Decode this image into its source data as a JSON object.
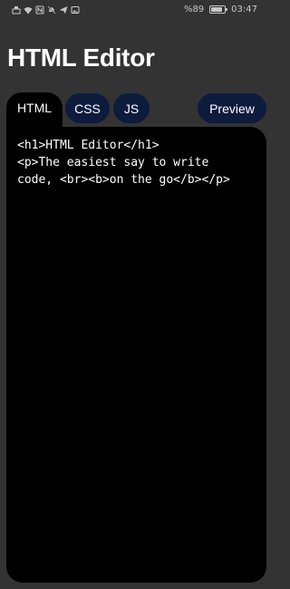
{
  "status_bar": {
    "icons": [
      "ethernet-icon",
      "wifi-icon",
      "nfc-icon",
      "mute-icon",
      "send-icon",
      "gallery-icon"
    ],
    "battery_percent": "%89",
    "battery_level": 0.89,
    "time": "03:47"
  },
  "app": {
    "title": "HTML Editor"
  },
  "tabs": {
    "html": "HTML",
    "css": "CSS",
    "js": "JS",
    "preview": "Preview",
    "active": "html"
  },
  "editor": {
    "lines": [
      "<h1>HTML Editor</h1>",
      "<p>The easiest say to write",
      "code, <br><b>on the go</b></p>"
    ]
  },
  "colors": {
    "background": "#333333",
    "editor_background": "#000000",
    "tab_background": "#0d1b3d",
    "text": "#ffffff"
  }
}
